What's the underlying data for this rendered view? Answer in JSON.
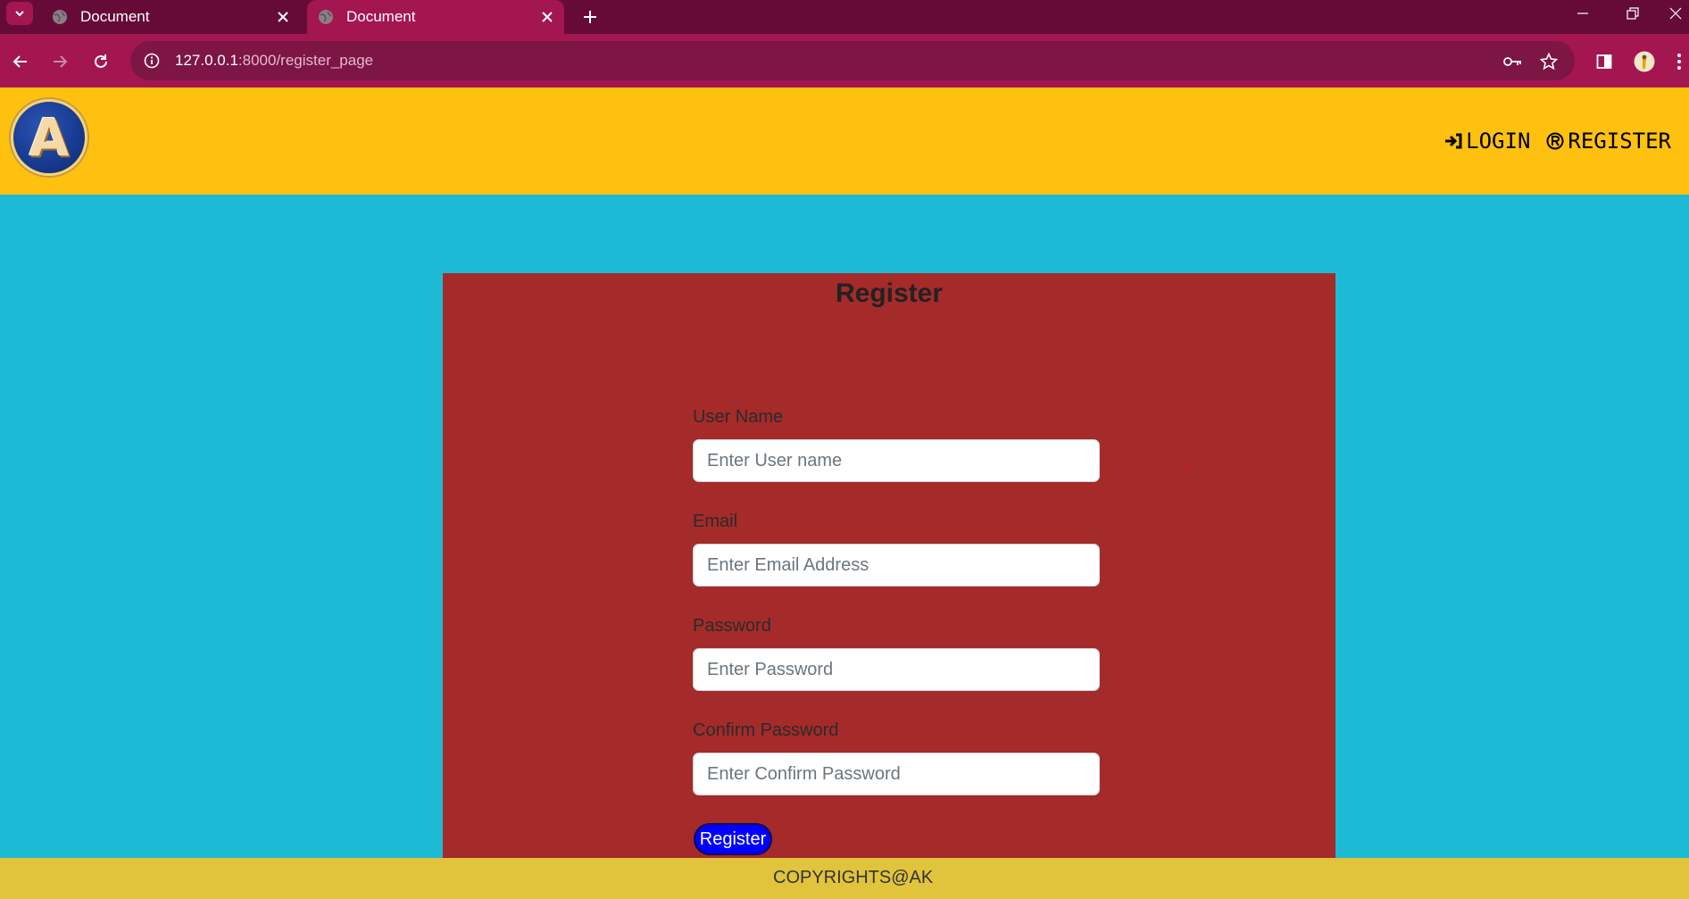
{
  "browser": {
    "tabs": [
      {
        "title": "Document",
        "active": false
      },
      {
        "title": "Document",
        "active": true
      }
    ],
    "url_host": "127.0.0.1",
    "url_path": ":8000/register_page",
    "colors": {
      "tabbar": "#660b37",
      "toolbar": "#a3164f",
      "omnibox": "#7d1545"
    }
  },
  "header": {
    "logo_letter": "A",
    "nav": [
      {
        "label": "LOGIN",
        "icon": "login-arrow-icon"
      },
      {
        "label": "REGISTER",
        "icon": "registered-mark-icon"
      }
    ],
    "background": "#fec10f"
  },
  "form": {
    "title": "Register",
    "fields": [
      {
        "label": "User Name",
        "placeholder": "Enter User name",
        "type": "text"
      },
      {
        "label": "Email",
        "placeholder": "Enter Email Address",
        "type": "email"
      },
      {
        "label": "Password",
        "placeholder": "Enter Password",
        "type": "password"
      },
      {
        "label": "Confirm Password",
        "placeholder": "Enter Confirm Password",
        "type": "password"
      }
    ],
    "submit_label": "Register",
    "card_color": "#a52a2a",
    "button_color": "#0000ff"
  },
  "footer": {
    "text": "COPYRIGHTS@AK",
    "background": "#e1c33c"
  },
  "page_background": "#1dbad6"
}
